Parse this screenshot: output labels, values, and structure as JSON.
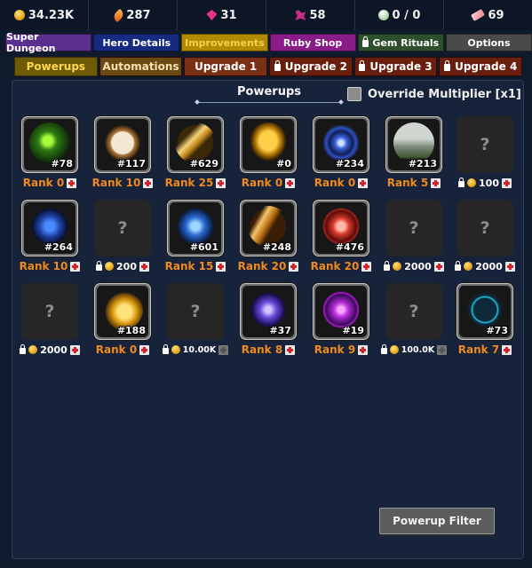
{
  "resources": [
    {
      "icon": "gold-coin-icon",
      "value": "34.23K"
    },
    {
      "icon": "feather-icon",
      "value": "287"
    },
    {
      "icon": "ruby-icon",
      "value": "31"
    },
    {
      "icon": "gem-shards-icon",
      "value": "58"
    },
    {
      "icon": "egg-icon",
      "value": "0 / 0"
    },
    {
      "icon": "ticket-icon",
      "value": "69"
    }
  ],
  "main_tabs": [
    {
      "label": "Super Dungeon"
    },
    {
      "label": "Hero Details"
    },
    {
      "label": "Improvements"
    },
    {
      "label": "Ruby Shop"
    },
    {
      "label": "Gem Rituals"
    },
    {
      "label": "Options"
    }
  ],
  "sub_tabs": [
    {
      "label": "Powerups"
    },
    {
      "label": "Automations"
    },
    {
      "label": "Upgrade 1"
    },
    {
      "label": "Upgrade 2"
    },
    {
      "label": "Upgrade 3"
    },
    {
      "label": "Upgrade 4"
    }
  ],
  "panel": {
    "title": "Powerups",
    "override_label": "Override Multiplier [x1]",
    "filter_button": "Powerup Filter"
  },
  "powerups": [
    {
      "state": "owned",
      "icon": "leaf-orb-icon",
      "number": "#78",
      "rank": "Rank 0"
    },
    {
      "state": "owned",
      "icon": "pocket-watch-icon",
      "number": "#117",
      "rank": "Rank 10"
    },
    {
      "state": "owned",
      "icon": "golden-sword-icon",
      "number": "#629",
      "rank": "Rank 25"
    },
    {
      "state": "owned",
      "icon": "spartan-helmet-icon",
      "number": "#0",
      "rank": "Rank 0"
    },
    {
      "state": "owned",
      "icon": "blue-vortex-icon",
      "number": "#234",
      "rank": "Rank 0"
    },
    {
      "state": "owned",
      "icon": "iron-boots-icon",
      "number": "#213",
      "rank": "Rank 5"
    },
    {
      "state": "locked",
      "cost": "100"
    },
    {
      "state": "owned",
      "icon": "blue-dragon-icon",
      "number": "#264",
      "rank": "Rank 10"
    },
    {
      "state": "locked",
      "cost": "200"
    },
    {
      "state": "owned",
      "icon": "blue-shield-icon",
      "number": "#601",
      "rank": "Rank 15"
    },
    {
      "state": "owned",
      "icon": "golden-claw-icon",
      "number": "#248",
      "rank": "Rank 20"
    },
    {
      "state": "owned",
      "icon": "red-skull-icon",
      "number": "#476",
      "rank": "Rank 20"
    },
    {
      "state": "locked",
      "cost": "2000"
    },
    {
      "state": "locked",
      "cost": "2000"
    },
    {
      "state": "locked",
      "cost": "2000"
    },
    {
      "state": "owned",
      "icon": "gold-coins-icon",
      "number": "#188",
      "rank": "Rank 0"
    },
    {
      "state": "locked",
      "cost": "10.00K"
    },
    {
      "state": "owned",
      "icon": "purple-wind-icon",
      "number": "#37",
      "rank": "Rank 8"
    },
    {
      "state": "owned",
      "icon": "purple-eye-icon",
      "number": "#19",
      "rank": "Rank 9"
    },
    {
      "state": "locked",
      "cost": "100.0K"
    },
    {
      "state": "owned",
      "icon": "cyan-arrows-icon",
      "number": "#73",
      "rank": "Rank 7"
    }
  ],
  "colors": {
    "background": "#0f1b2d",
    "panel": "#16233a",
    "rank_text": "#f08a1e",
    "active_tab": "#b28b00"
  }
}
